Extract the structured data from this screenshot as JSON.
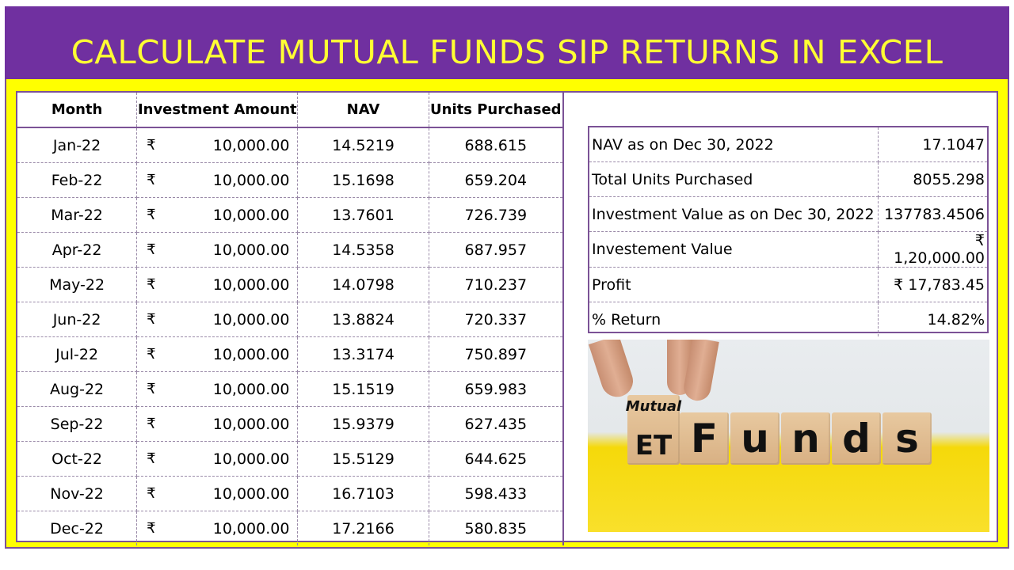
{
  "header": {
    "title": "CALCULATE MUTUAL FUNDS SIP RETURNS IN EXCEL"
  },
  "colors": {
    "banner_bg": "#7030A0",
    "title_text": "#FFFF33",
    "frame": "#FFFF00",
    "border": "#7B5296"
  },
  "sip_table": {
    "columns": [
      "Month",
      "Investment Amount",
      "NAV",
      "Units Purchased"
    ],
    "currency_symbol": "₹",
    "rows": [
      {
        "month": "Jan-22",
        "amount": "10,000.00",
        "nav": "14.5219",
        "units": "688.615"
      },
      {
        "month": "Feb-22",
        "amount": "10,000.00",
        "nav": "15.1698",
        "units": "659.204"
      },
      {
        "month": "Mar-22",
        "amount": "10,000.00",
        "nav": "13.7601",
        "units": "726.739"
      },
      {
        "month": "Apr-22",
        "amount": "10,000.00",
        "nav": "14.5358",
        "units": "687.957"
      },
      {
        "month": "May-22",
        "amount": "10,000.00",
        "nav": "14.0798",
        "units": "710.237"
      },
      {
        "month": "Jun-22",
        "amount": "10,000.00",
        "nav": "13.8824",
        "units": "720.337"
      },
      {
        "month": "Jul-22",
        "amount": "10,000.00",
        "nav": "13.3174",
        "units": "750.897"
      },
      {
        "month": "Aug-22",
        "amount": "10,000.00",
        "nav": "15.1519",
        "units": "659.983"
      },
      {
        "month": "Sep-22",
        "amount": "10,000.00",
        "nav": "15.9379",
        "units": "627.435"
      },
      {
        "month": "Oct-22",
        "amount": "10,000.00",
        "nav": "15.5129",
        "units": "644.625"
      },
      {
        "month": "Nov-22",
        "amount": "10,000.00",
        "nav": "16.7103",
        "units": "598.433"
      },
      {
        "month": "Dec-22",
        "amount": "10,000.00",
        "nav": "17.2166",
        "units": "580.835"
      }
    ]
  },
  "summary": {
    "rows": [
      {
        "label": "NAV as on Dec 30, 2022",
        "value": "17.1047"
      },
      {
        "label": "Total Units Purchased",
        "value": "8055.298"
      },
      {
        "label": "Investment Value as on Dec 30, 2022",
        "value": "137783.4506"
      },
      {
        "label": "Investement Value",
        "value": "₹ 1,20,000.00"
      },
      {
        "label": "Profit",
        "value": "₹ 17,783.45"
      },
      {
        "label": "% Return",
        "value": "14.82%"
      }
    ]
  },
  "photo": {
    "top_face_text": "Mutual",
    "front_letters": [
      "ET",
      "F",
      "u",
      "n",
      "d",
      "s"
    ]
  }
}
